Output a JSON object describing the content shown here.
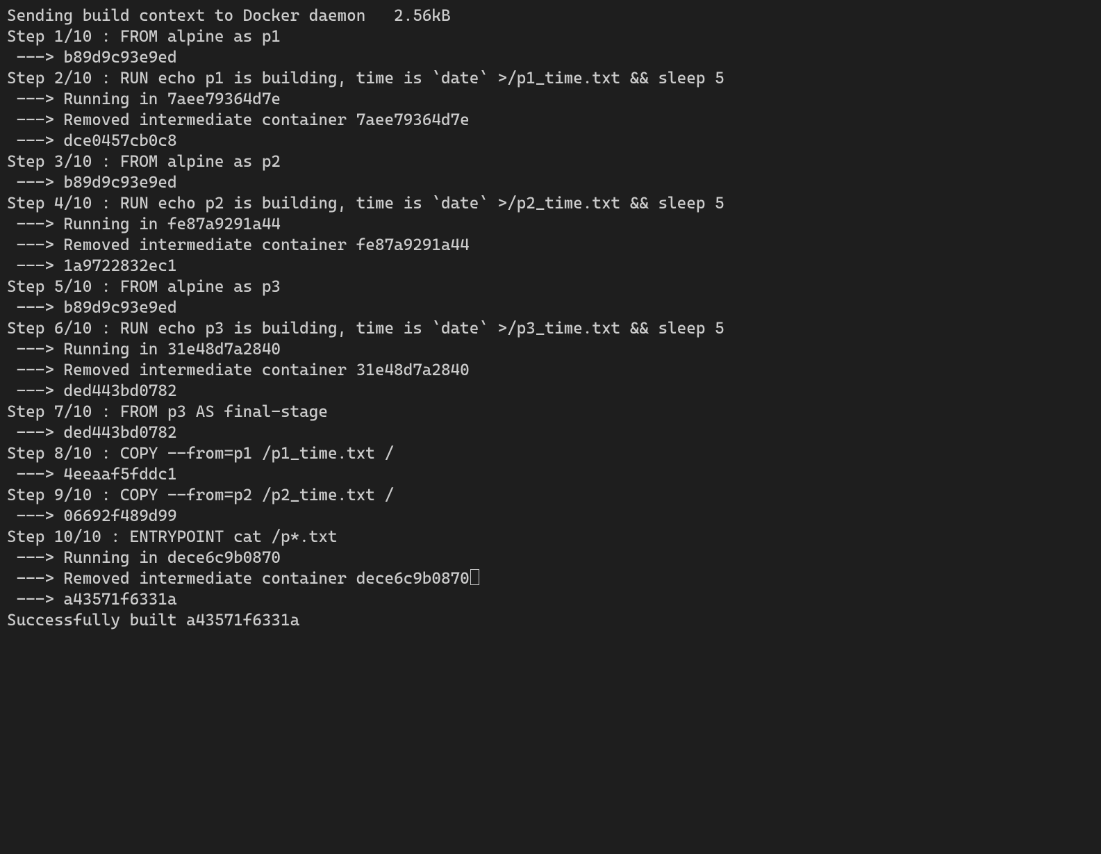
{
  "lines": [
    "Sending build context to Docker daemon   2.56kB",
    "Step 1/10 : FROM alpine as p1",
    " ---> b89d9c93e9ed",
    "Step 2/10 : RUN echo p1 is building, time is `date` >/p1_time.txt && sleep 5",
    " ---> Running in 7aee79364d7e",
    " ---> Removed intermediate container 7aee79364d7e",
    " ---> dce0457cb0c8",
    "Step 3/10 : FROM alpine as p2",
    " ---> b89d9c93e9ed",
    "Step 4/10 : RUN echo p2 is building, time is `date` >/p2_time.txt && sleep 5",
    " ---> Running in fe87a9291a44",
    " ---> Removed intermediate container fe87a9291a44",
    " ---> 1a9722832ec1",
    "Step 5/10 : FROM alpine as p3",
    " ---> b89d9c93e9ed",
    "Step 6/10 : RUN echo p3 is building, time is `date` >/p3_time.txt && sleep 5",
    " ---> Running in 31e48d7a2840",
    " ---> Removed intermediate container 31e48d7a2840",
    " ---> ded443bd0782",
    "Step 7/10 : FROM p3 AS final-stage",
    " ---> ded443bd0782",
    "Step 8/10 : COPY --from=p1 /p1_time.txt /",
    " ---> 4eeaaf5fddc1",
    "Step 9/10 : COPY --from=p2 /p2_time.txt /",
    " ---> 06692f489d99",
    "Step 10/10 : ENTRYPOINT cat /p*.txt",
    " ---> Running in dece6c9b0870",
    " ---> Removed intermediate container dece6c9b0870",
    " ---> a43571f6331a",
    "Successfully built a43571f6331a"
  ],
  "cursor_after_line_index": 27
}
